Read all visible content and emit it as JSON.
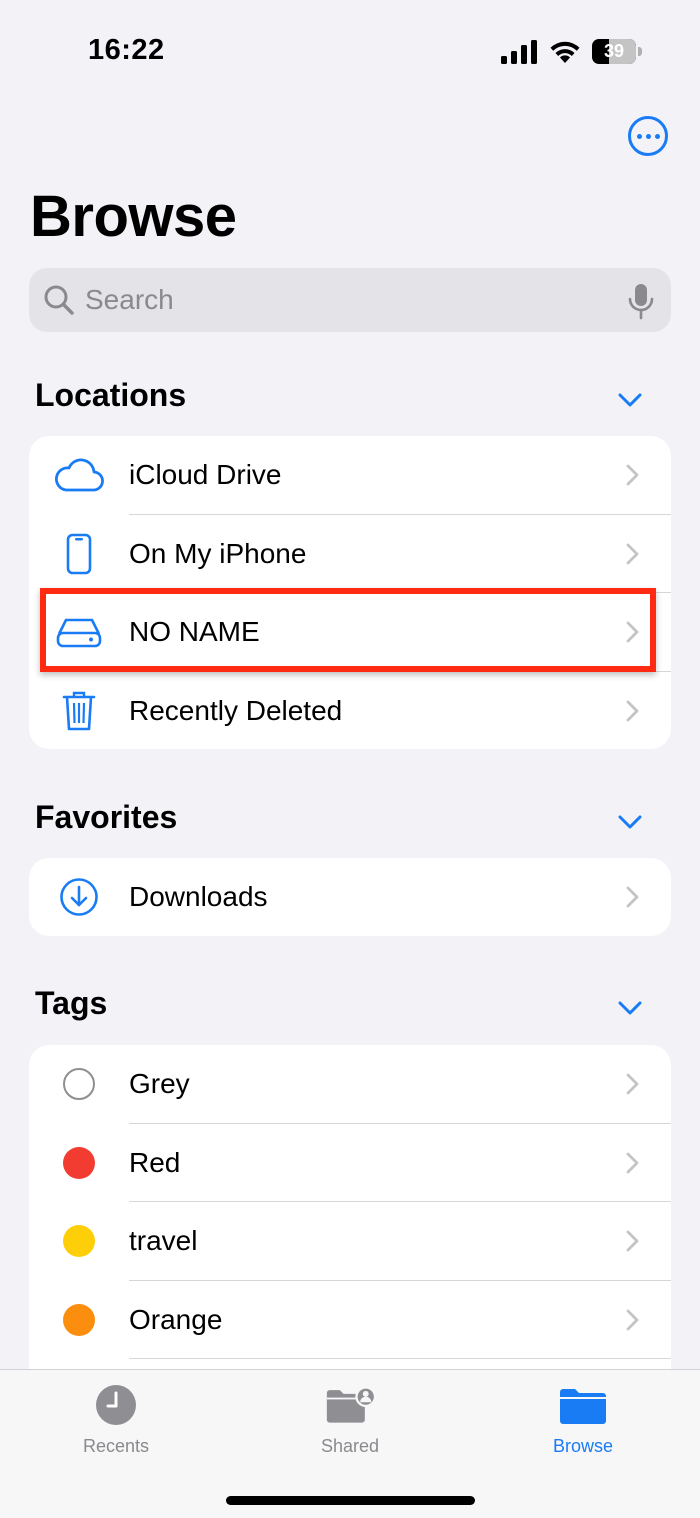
{
  "status_bar": {
    "time": "16:22",
    "battery_level": "39",
    "battery_fraction": 0.39
  },
  "page": {
    "title": "Browse"
  },
  "search": {
    "placeholder": "Search"
  },
  "sections": {
    "locations": {
      "header": "Locations",
      "items": [
        {
          "label": "iCloud Drive",
          "icon": "cloud-icon"
        },
        {
          "label": "On My iPhone",
          "icon": "iphone-icon"
        },
        {
          "label": "NO NAME",
          "icon": "external-drive-icon",
          "highlighted": true
        },
        {
          "label": "Recently Deleted",
          "icon": "trash-icon"
        }
      ]
    },
    "favorites": {
      "header": "Favorites",
      "items": [
        {
          "label": "Downloads",
          "icon": "download-circle-icon"
        }
      ]
    },
    "tags": {
      "header": "Tags",
      "items": [
        {
          "label": "Grey",
          "color": "#ffffff",
          "outline": "#8e8e93"
        },
        {
          "label": "Red",
          "color": "#f23c32"
        },
        {
          "label": "travel",
          "color": "#fecf09"
        },
        {
          "label": "Orange",
          "color": "#fb8e0e"
        }
      ]
    }
  },
  "tab_bar": {
    "tabs": [
      {
        "label": "Recents",
        "icon": "clock-icon",
        "active": false
      },
      {
        "label": "Shared",
        "icon": "shared-folder-icon",
        "active": false
      },
      {
        "label": "Browse",
        "icon": "folder-icon",
        "active": true
      }
    ]
  },
  "colors": {
    "accent": "#1a7cf5",
    "highlight": "#ff2a12",
    "background": "#f2f2f7"
  }
}
